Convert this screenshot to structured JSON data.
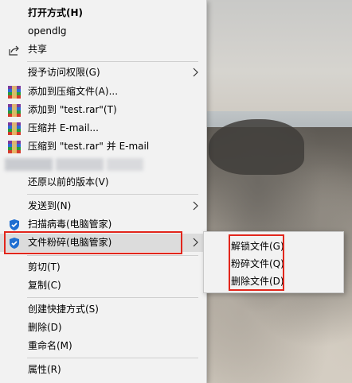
{
  "menu": {
    "open_with": "打开方式(H)",
    "opendlg": "opendlg",
    "share": "共享",
    "grant_access": "授予访问权限(G)",
    "add_to_archive": "添加到压缩文件(A)...",
    "add_to_test_rar": "添加到 \"test.rar\"(T)",
    "compress_email": "压缩并 E-mail...",
    "compress_test_rar_email": "压缩到 \"test.rar\" 并 E-mail",
    "restore_previous": "还原以前的版本(V)",
    "send_to": "发送到(N)",
    "scan_virus": "扫描病毒(电脑管家)",
    "file_shred": "文件粉碎(电脑管家)",
    "cut": "剪切(T)",
    "copy": "复制(C)",
    "create_shortcut": "创建快捷方式(S)",
    "delete": "删除(D)",
    "rename": "重命名(M)",
    "properties": "属性(R)"
  },
  "submenu": {
    "unlock_file": "解锁文件(G)",
    "shred_file": "粉碎文件(Q)",
    "delete_file": "删除文件(D)"
  },
  "colors": {
    "highlight_box": "#e2261c",
    "menu_bg": "#f2f2f2",
    "hover_bg": "#dcdcdc",
    "shield_blue": "#1f6fd1"
  }
}
